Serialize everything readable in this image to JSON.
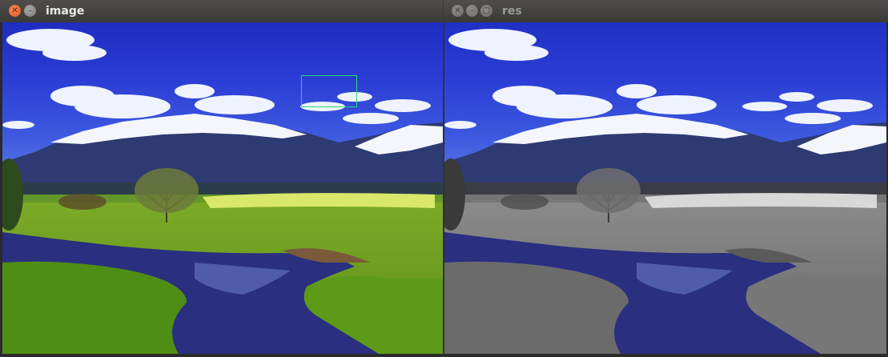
{
  "windows": {
    "left": {
      "title": "image"
    },
    "right": {
      "title": "res"
    }
  },
  "colors": {
    "roi_box": "#22e06a",
    "titlebar": "#3b3a37",
    "close_button_active": "#e0531d"
  },
  "icons": {
    "close": "close-icon",
    "minimize": "minimize-icon",
    "maximize": "maximize-icon"
  }
}
